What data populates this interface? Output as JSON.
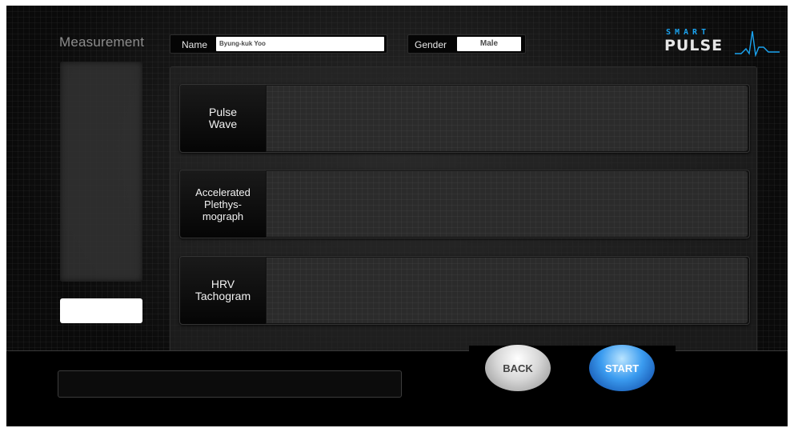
{
  "header": {
    "title": "Measurement",
    "name_label": "Name",
    "name_value": "Byung-kuk Yoo",
    "gender_label": "Gender",
    "gender_value": "Male"
  },
  "logo": {
    "top": "SMART",
    "bottom": "PULSE",
    "accent_color": "#1aa3f0"
  },
  "rows": [
    {
      "label": "Pulse\nWave"
    },
    {
      "label": "Accelerated\nPlethys-\nmograph"
    },
    {
      "label": "HRV\nTachogram"
    }
  ],
  "buttons": {
    "back": "BACK",
    "start": "START"
  },
  "colors": {
    "start_button": "#3b9cf0",
    "back_button": "#d8d8d8",
    "background": "#0a0a0a"
  }
}
